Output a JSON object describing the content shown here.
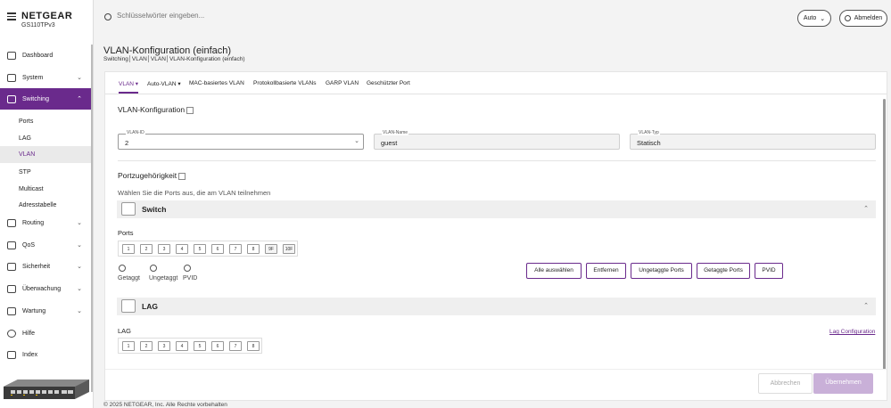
{
  "header": {
    "logo": "NETGEAR",
    "model": "GS110TPv3",
    "search_placeholder": "Schlüsselwörter eingeben...",
    "auto_label": "Auto",
    "logout_label": "Abmelden"
  },
  "sidebar": {
    "items": [
      {
        "label": "Dashboard",
        "icon": "dashboard-icon"
      },
      {
        "label": "System",
        "icon": "system-icon"
      },
      {
        "label": "Switching",
        "icon": "switching-icon"
      },
      {
        "label": "Routing",
        "icon": "routing-icon"
      },
      {
        "label": "QoS",
        "icon": "qos-icon"
      },
      {
        "label": "Sicherheit",
        "icon": "shield-icon"
      },
      {
        "label": "Überwachung",
        "icon": "monitor-icon"
      },
      {
        "label": "Wartung",
        "icon": "wrench-icon"
      },
      {
        "label": "Hilfe",
        "icon": "help-icon"
      },
      {
        "label": "Index",
        "icon": "index-icon"
      }
    ],
    "sub_items": [
      "Ports",
      "LAG",
      "VLAN",
      "STP",
      "Multicast",
      "Adresstabelle"
    ]
  },
  "page": {
    "title": "VLAN-Konfiguration (einfach)",
    "breadcrumb": "Switching│VLAN│VLAN│VLAN-Konfiguration (einfach)"
  },
  "tabs": [
    "VLAN ▾",
    "Auto-VLAN ▾",
    "MAC-basiertes VLAN",
    "Protokollbasierte VLANs",
    "GARP VLAN",
    "Geschützter Port"
  ],
  "vlan_config": {
    "title": "VLAN-Konfiguration",
    "vlan_id_label": "VLAN-ID",
    "vlan_id_value": "2",
    "vlan_name_label": "VLAN-Name",
    "vlan_name_value": "guest",
    "vlan_type_label": "VLAN-Typ",
    "vlan_type_value": "Statisch"
  },
  "membership": {
    "title": "Portzugehörigkeit",
    "hint": "Wählen Sie die Ports aus, die am VLAN teilnehmen",
    "switch_title": "Switch",
    "ports_label": "Ports",
    "switch_ports": [
      "1",
      "2",
      "3",
      "4",
      "5",
      "6",
      "7",
      "8",
      "9F",
      "10F"
    ],
    "legend": [
      "Getaggt",
      "Ungetaggt",
      "PVID"
    ],
    "buttons": [
      "Alle auswählen",
      "Entfernen",
      "Ungetaggte Ports",
      "Getaggte Ports",
      "PVID"
    ],
    "lag_title": "LAG",
    "lag_label": "LAG",
    "lag_link": "Lag Configuration",
    "lag_ports": [
      "1",
      "2",
      "3",
      "4",
      "5",
      "6",
      "7",
      "8"
    ]
  },
  "footer": {
    "cancel": "Abbrechen",
    "apply": "Übernehmen",
    "copyright": "© 2025 NETGEAR, Inc. Alle Rechte vorbehalten"
  },
  "colors": {
    "accent": "#6a2a8c",
    "apply_bg": "#c9b0d8"
  }
}
